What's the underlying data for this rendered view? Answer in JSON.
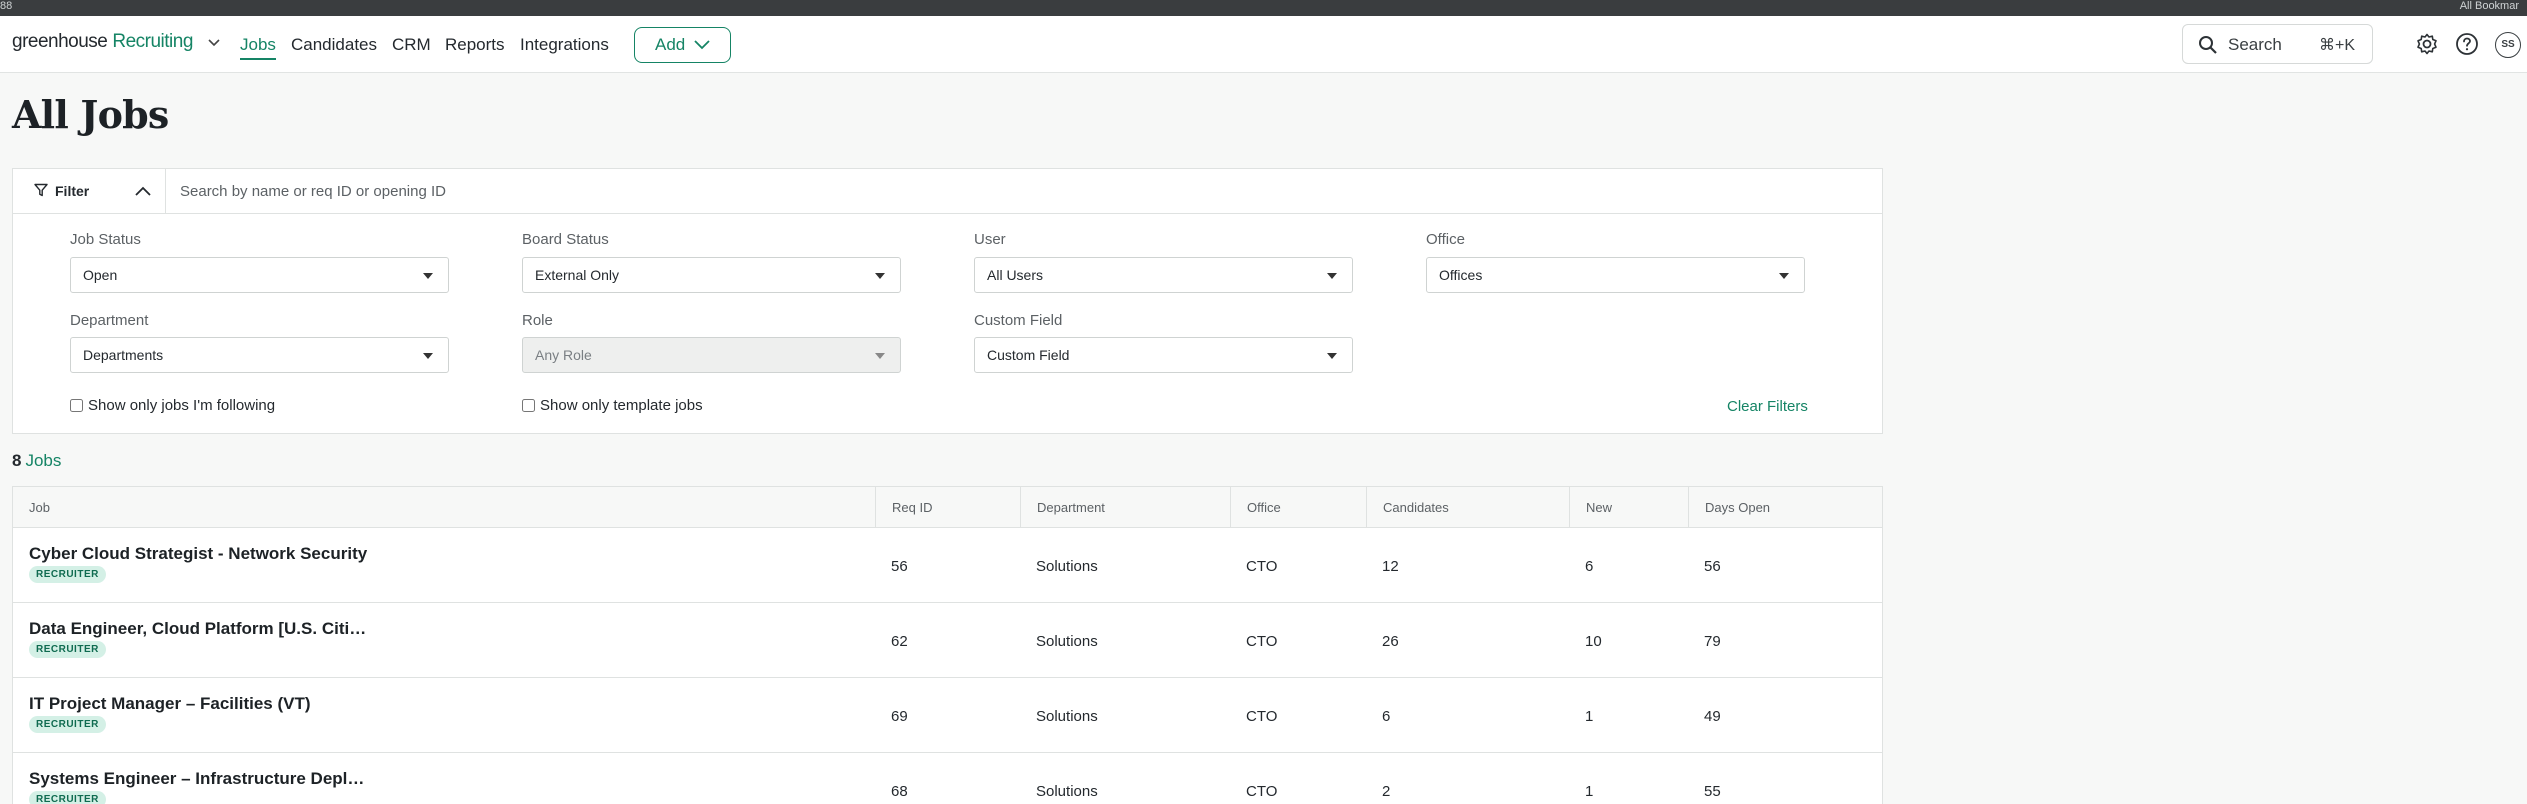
{
  "nav": {
    "brand": "greenhouse",
    "brand_sub": "Recruiting",
    "links": [
      "Jobs",
      "Candidates",
      "CRM",
      "Reports",
      "Integrations"
    ],
    "active": "Jobs",
    "add_label": "Add",
    "search_label": "Search",
    "search_shortcut": "⌘+K",
    "user_initials": "SS"
  },
  "topstrip": {
    "left_text": "88",
    "right_text": "All Bookmar"
  },
  "page": {
    "title": "All Jobs"
  },
  "filters": {
    "toggle_label": "Filter",
    "search_placeholder": "Search by name or req ID or opening ID",
    "job_status": {
      "label": "Job Status",
      "value": "Open"
    },
    "board_status": {
      "label": "Board Status",
      "value": "External Only"
    },
    "user": {
      "label": "User",
      "value": "All Users"
    },
    "office": {
      "label": "Office",
      "value": "Offices"
    },
    "department": {
      "label": "Department",
      "value": "Departments"
    },
    "role": {
      "label": "Role",
      "value": "Any Role"
    },
    "custom_field": {
      "label": "Custom Field",
      "value": "Custom Field"
    },
    "following_label": "Show only jobs I'm following",
    "template_label": "Show only template jobs",
    "clear_label": "Clear Filters"
  },
  "summary": {
    "count": "8",
    "label": "Jobs"
  },
  "table": {
    "headers": [
      "Job",
      "Req ID",
      "Department",
      "Office",
      "Candidates",
      "New",
      "Days Open"
    ],
    "rows": [
      {
        "job": "Cyber Cloud Strategist - Network Security",
        "badge": "RECRUITER",
        "req_id": "56",
        "department": "Solutions",
        "office": "CTO",
        "candidates": "12",
        "new": "6",
        "days_open": "56"
      },
      {
        "job": "Data Engineer, Cloud Platform [U.S. Citizenship Required]",
        "badge": "RECRUITER",
        "req_id": "62",
        "department": "Solutions",
        "office": "CTO",
        "candidates": "26",
        "new": "10",
        "days_open": "79"
      },
      {
        "job": "IT Project Manager – Facilities (VT)",
        "badge": "RECRUITER",
        "req_id": "69",
        "department": "Solutions",
        "office": "CTO",
        "candidates": "6",
        "new": "1",
        "days_open": "49"
      },
      {
        "job": "Systems Engineer – Infrastructure Deployment",
        "badge": "RECRUITER",
        "req_id": "68",
        "department": "Solutions",
        "office": "CTO",
        "candidates": "2",
        "new": "1",
        "days_open": "55"
      }
    ]
  },
  "colors": {
    "accent": "#158465",
    "badge_bg": "#d4f0e6",
    "page_bg": "#f7f8f7"
  },
  "icons": [
    "grid-icon",
    "bookmark-icon",
    "chevron-down-icon",
    "search-icon",
    "gear-icon",
    "help-icon",
    "filter-icon",
    "chevron-up-icon"
  ]
}
